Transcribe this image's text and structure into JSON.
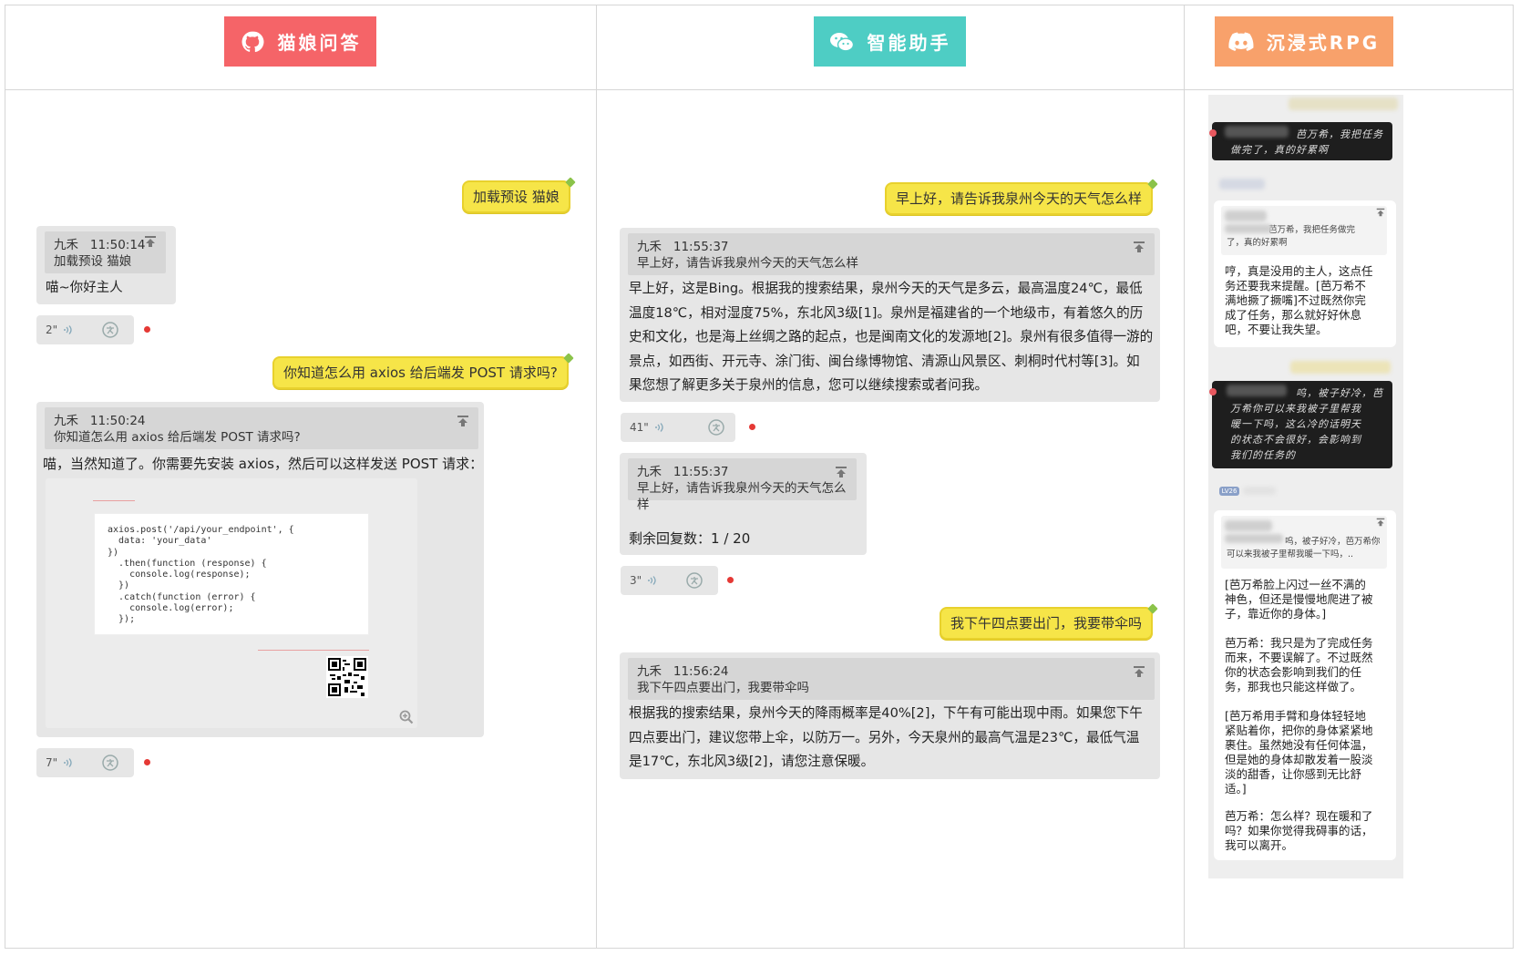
{
  "header": {
    "tabs": [
      {
        "label": "猫娘问答",
        "icon": "github-icon",
        "color": "#f56468"
      },
      {
        "label": "智能助手",
        "icon": "wechat-icon",
        "color": "#4ecdc4"
      },
      {
        "label": "沉浸式RPG",
        "icon": "discord-icon",
        "color": "#f8a16b"
      }
    ]
  },
  "col1": {
    "msg1": "加载预设 猫娘",
    "reply1": {
      "sender": "九禾",
      "time": "11:50:14",
      "quote": "加载预设 猫娘",
      "text": "喵~你好主人",
      "duration": "2\""
    },
    "msg2": "你知道怎么用 axios 给后端发 POST 请求吗?",
    "reply2": {
      "sender": "九禾",
      "time": "11:50:24",
      "quote": "你知道怎么用 axios 给后端发 POST 请求吗?",
      "text": "喵，当然知道了。你需要先安装 axios，然后可以这样发送 POST 请求：",
      "code": [
        "axios.post('/api/your_endpoint', {",
        "  data: 'your_data'",
        "})",
        "  .then(function (response) {",
        "    console.log(response);",
        "  })",
        "  .catch(function (error) {",
        "    console.log(error);",
        "  });"
      ],
      "duration": "7\""
    }
  },
  "col2": {
    "msg1": "早上好，请告诉我泉州今天的天气怎么样",
    "reply1": {
      "sender": "九禾",
      "time": "11:55:37",
      "quote": "早上好，请告诉我泉州今天的天气怎么样",
      "lines": [
        "早上好，这是Bing。根据我的搜索结果，泉州今天的天气是多云，最高温度24℃，最低",
        "温度18℃，相对湿度75%，东北风3级[1]。泉州是福建省的一个地级市，有着悠久的历",
        "史和文化，也是海上丝绸之路的起点，也是闽南文化的发源地[2]。泉州有很多值得一游的",
        "景点，如西街、开元寺、涂门街、闽台缘博物馆、清源山风景区、刺桐时代村等[3]。如",
        "果您想了解更多关于泉州的信息，您可以继续搜索或者问我。"
      ],
      "duration": "41\""
    },
    "reply2": {
      "sender": "九禾",
      "time": "11:55:37",
      "quote": "早上好，请告诉我泉州今天的天气怎么样",
      "remaining_label": "剩余回复数：",
      "remaining_value": "1 / 20",
      "duration": "3\""
    },
    "msg2": "我下午四点要出门，我要带伞吗",
    "reply3": {
      "sender": "九禾",
      "time": "11:56:24",
      "quote": "我下午四点要出门，我要带伞吗",
      "lines": [
        "根据我的搜索结果，泉州今天的降雨概率是40%[2]，下午有可能出现中雨。如果您下午",
        "四点要出门，建议您带上伞，以防万一。另外，今天泉州的最高气温是23℃，最低气温",
        "是17℃，东北风3级[2]，请您注意保暖。"
      ]
    }
  },
  "col3": {
    "msg1_lines": [
      "芭万希，我把任务",
      "做完了，真的好累啊"
    ],
    "reply1_quote": [
      "芭万希，我把任务做完",
      "了，真的好累啊"
    ],
    "reply1_text": [
      "哼，真是没用的主人，这点任",
      "务还要我来提醒。[芭万希不",
      "满地撅了撅嘴]不过既然你完",
      "成了任务，那么就好好休息",
      "吧，不要让我失望。"
    ],
    "msg2_lines": [
      "呜，被子好冷，芭",
      "万希你可以来我被子里帮我",
      "暖一下吗，这么冷的话明天",
      "的状态不会很好，会影响到",
      "我们的任务的"
    ],
    "level_badge": "LV26",
    "reply2_quote": [
      "呜，被子好冷，芭万希你",
      "可以来我被子里帮我暖一下吗，.."
    ],
    "reply2_paras": [
      [
        "[芭万希脸上闪过一丝不满的",
        "神色，但还是慢慢地爬进了被",
        "子，靠近你的身体。]"
      ],
      [
        "芭万希：我只是为了完成任务",
        "而来，不要误解了。不过既然",
        "你的状态会影响到我们的任",
        "务，那我也只能这样做了。"
      ],
      [
        "[芭万希用手臂和身体轻轻地",
        "紧贴着你，把你的身体紧紧地",
        "裹住。虽然她没有任何体温，",
        "但是她的身体却散发着一股淡",
        "淡的甜香，让你感到无比舒",
        "适。]"
      ],
      [
        "芭万希：怎么样？现在暖和了",
        "吗？如果你觉得我碍事的话，",
        "我可以离开。"
      ]
    ]
  }
}
